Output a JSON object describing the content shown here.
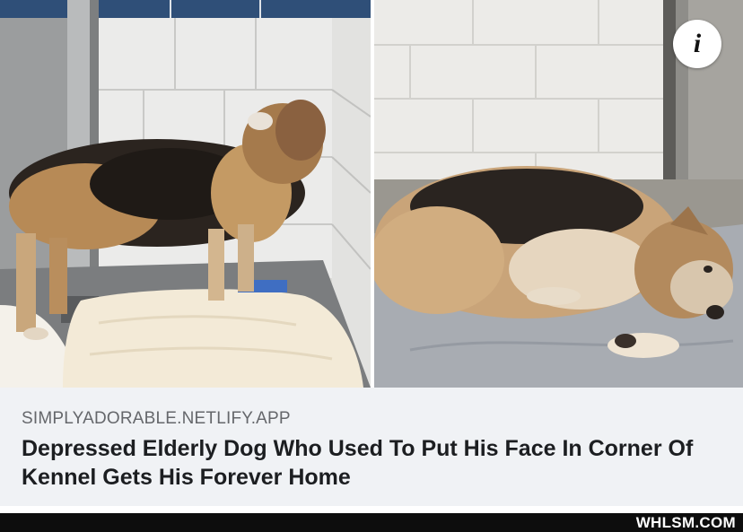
{
  "post": {
    "domain": "SIMPLYADORABLE.NETLIFY.APP",
    "title": "Depressed Elderly Dog Who Used To Put His Face In Corner Of Kennel Gets His Forever Home"
  },
  "info_button": {
    "icon": "info-icon",
    "glyph": "i"
  },
  "watermark": "WHLSM.COM",
  "colors": {
    "card_bg": "#f0f2f5",
    "title": "#1c1e21",
    "domain": "#65676b",
    "footer": "#0d0d0d"
  }
}
